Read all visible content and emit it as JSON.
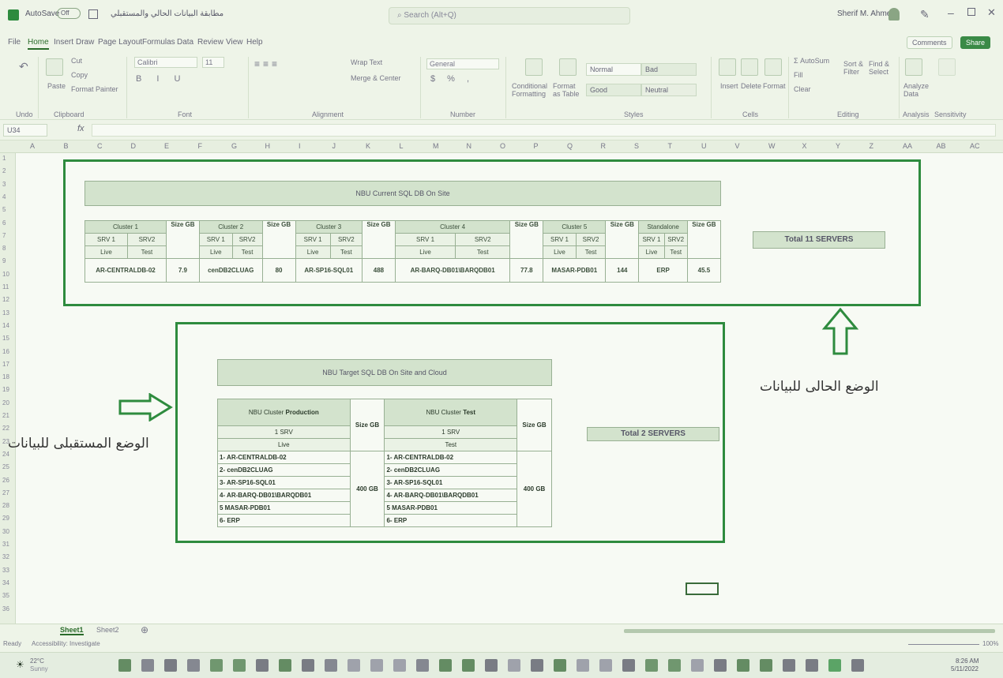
{
  "titlebar": {
    "autosave": "AutoSave",
    "autosave_state": "Off",
    "file_name": "مطابقة البيانات الحالي والمستقبلي",
    "search_placeholder": "Search (Alt+Q)",
    "user": "Sherif M. Ahmed"
  },
  "menu": [
    "File",
    "Home",
    "Insert",
    "Draw",
    "Page Layout",
    "Formulas",
    "Data",
    "Review",
    "View",
    "Help"
  ],
  "menu_active": "Home",
  "comments_label": "Comments",
  "share_label": "Share",
  "ribbon": {
    "undo_label": "Undo",
    "clipboard": {
      "paste": "Paste",
      "cut": "Cut",
      "copy": "Copy",
      "format_painter": "Format Painter",
      "label": "Clipboard"
    },
    "font": {
      "name": "Calibri",
      "size": "11",
      "label": "Font"
    },
    "alignment": {
      "wrap": "Wrap Text",
      "merge": "Merge & Center",
      "label": "Alignment"
    },
    "number": {
      "format": "General",
      "label": "Number"
    },
    "styles": {
      "conditional": "Conditional Formatting",
      "format_table": "Format as Table",
      "normal": "Normal",
      "bad": "Bad",
      "good": "Good",
      "neutral": "Neutral",
      "label": "Styles"
    },
    "cells": {
      "insert": "Insert",
      "delete": "Delete",
      "format": "Format",
      "label": "Cells"
    },
    "editing": {
      "autosum": "AutoSum",
      "fill": "Fill",
      "clear": "Clear",
      "sort": "Sort & Filter",
      "find": "Find & Select",
      "label": "Editing"
    },
    "analysis": {
      "analyze": "Analyze Data",
      "label": "Analysis"
    },
    "sensitivity": {
      "label": "Sensitivity"
    }
  },
  "formula_bar": {
    "cell_ref": "U34",
    "fx": "fx"
  },
  "columns": [
    "A",
    "B",
    "C",
    "D",
    "E",
    "F",
    "G",
    "H",
    "I",
    "J",
    "K",
    "L",
    "M",
    "N",
    "O",
    "P",
    "Q",
    "R",
    "S",
    "T",
    "U",
    "V",
    "W",
    "X",
    "Y",
    "Z",
    "AA",
    "AB",
    "AC"
  ],
  "rows": [
    "1",
    "2",
    "3",
    "4",
    "5",
    "6",
    "7",
    "8",
    "9",
    "10",
    "11",
    "12",
    "13",
    "14",
    "15",
    "16",
    "17",
    "18",
    "19",
    "20",
    "21",
    "22",
    "23",
    "24",
    "25",
    "26",
    "27",
    "28",
    "29",
    "30",
    "31",
    "32",
    "33",
    "34",
    "35",
    "36"
  ],
  "current": {
    "title": "NBU Current SQL DB On Site",
    "headers": [
      "Cluster 1",
      "Size GB",
      "Cluster 2",
      "Size GB",
      "Cluster 3",
      "Size GB",
      "Cluster 4",
      "Size GB",
      "Cluster 5",
      "Size GB",
      "Standalone",
      "Size GB"
    ],
    "srv1": "SRV 1",
    "srv2": "SRV2",
    "live": "Live",
    "test": "Test",
    "servers": [
      "AR-CENTRALDB-02",
      "cenDB2CLUAG",
      "AR-SP16-SQL01",
      "AR-BARQ-DB01\\BARQDB01",
      "MASAR-PDB01",
      "ERP"
    ],
    "sizes": [
      "7.9",
      "80",
      "488",
      "77.8",
      "144",
      "45.5"
    ],
    "total": "Total 11 SERVERS",
    "arabic_label": "الوضع الحالى للبيانات"
  },
  "target": {
    "title": "NBU Target  SQL DB On Site and Cloud",
    "prod_header_light": "NBU Cluster",
    "prod_header_bold": "Production",
    "test_header_light": "NBU Cluster",
    "test_header_bold": "Test",
    "size_header": "Size GB",
    "srv": "1 SRV",
    "live": "Live",
    "test": "Test",
    "prod_list": [
      "1- AR-CENTRALDB-02",
      "2- cenDB2CLUAG",
      "3- AR-SP16-SQL01",
      "4- AR-BARQ-DB01\\BARQDB01",
      "5 MASAR-PDB01",
      "6- ERP"
    ],
    "test_list": [
      "1- AR-CENTRALDB-02",
      "2- cenDB2CLUAG",
      "3- AR-SP16-SQL01",
      "4- AR-BARQ-DB01\\BARQDB01",
      "5 MASAR-PDB01",
      "6- ERP"
    ],
    "prod_size": "400 GB",
    "test_size": "400 GB",
    "total": "Total 2 SERVERS",
    "arabic_label": "الوضع المستقبلى للبيانات"
  },
  "sheets": [
    "Sheet1",
    "Sheet2"
  ],
  "status": {
    "ready": "Ready",
    "accessibility": "Accessibility: Investigate",
    "zoom": "100%"
  },
  "taskbar": {
    "weather_temp": "22°C",
    "weather_text": "Sunny",
    "time": "8:26 AM",
    "date": "5/11/2022"
  },
  "colors": {
    "accent": "#2e8b3e",
    "header_fill": "#d3e3cd"
  }
}
